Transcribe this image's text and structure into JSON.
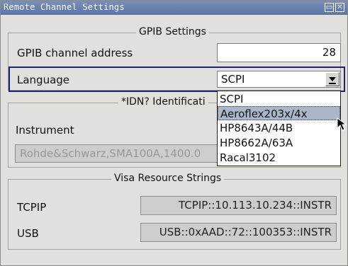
{
  "window": {
    "title": "Remote Channel Settings",
    "restore_glyph": "▭",
    "close_glyph": "✕"
  },
  "gpib": {
    "legend": "GPIB Settings",
    "channel_address_label": "GPIB channel address",
    "channel_address_value": "28",
    "language_label": "Language",
    "language_value": "SCPI",
    "language_options": [
      "SCPI",
      "Aeroflex203x/4x",
      "HP8643A/44B",
      "HP8662A/63A",
      "Racal3102"
    ],
    "highlighted_option": "Aeroflex203x/4x"
  },
  "idn": {
    "legend": "*IDN? Identificati",
    "instrument_label": "Instrument",
    "instrument_value": "Rohde&Schwarz,SMA100A,1400.0"
  },
  "visa": {
    "legend": "Visa Resource Strings",
    "tcpip_label": "TCPIP",
    "tcpip_value": "TCPIP::10.113.10.234::INSTR",
    "usb_label": "USB",
    "usb_value": "USB::0xAAD::72::100353::INSTR"
  },
  "colors": {
    "title_bar": "#6a80ae",
    "focus_border": "#1d2170",
    "highlight": "#aab6c9"
  }
}
